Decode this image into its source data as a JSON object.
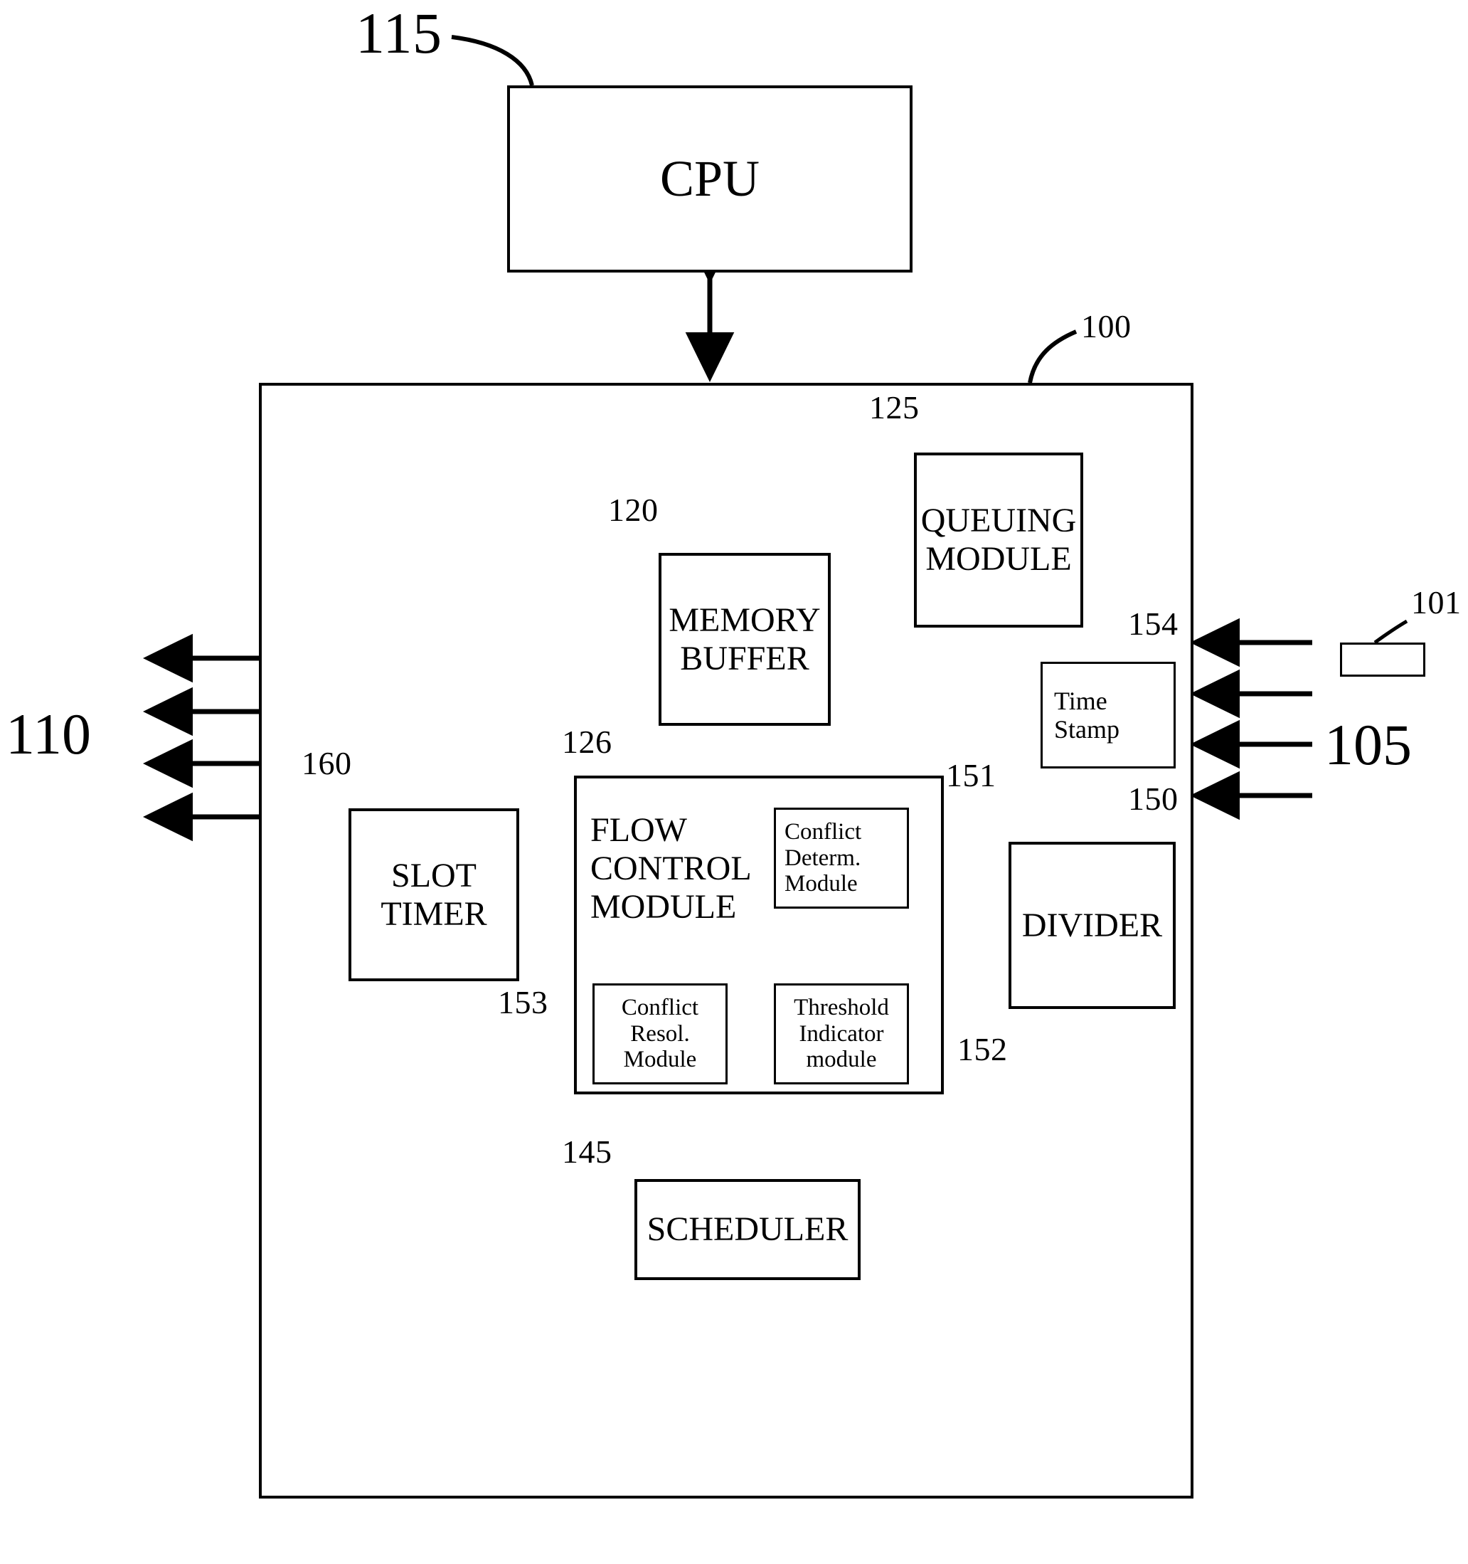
{
  "figure": {
    "type": "patent-block-diagram",
    "background_color": "#ffffff",
    "line_color": "#000000"
  },
  "blocks": {
    "cpu": {
      "label": "CPU",
      "ref": "115"
    },
    "device": {
      "ref": "100"
    },
    "memory_buffer": {
      "line1": "MEMORY",
      "line2": "BUFFER",
      "ref": "120"
    },
    "queuing_module": {
      "line1": "QUEUING",
      "line2": "MODULE",
      "ref": "125"
    },
    "time_stamp": {
      "line1": "Time",
      "line2": "Stamp",
      "ref": "154"
    },
    "slot_timer": {
      "line1": "SLOT",
      "line2": "TIMER",
      "ref": "160"
    },
    "flow_control_module": {
      "line1": "FLOW",
      "line2": "CONTROL",
      "line3": "MODULE",
      "ref": "126"
    },
    "conflict_determ_module": {
      "line1": "Conflict",
      "line2": "Determ.",
      "line3": "Module",
      "ref": "151"
    },
    "conflict_resol_module": {
      "line1": "Conflict",
      "line2": "Resol.",
      "line3": "Module",
      "ref": "153"
    },
    "threshold_indicator_module": {
      "line1": "Threshold",
      "line2": "Indicator",
      "line3": "module",
      "ref": "152"
    },
    "divider": {
      "label": "DIVIDER",
      "ref": "150"
    },
    "scheduler": {
      "label": "SCHEDULER",
      "ref": "145"
    },
    "packet": {
      "ref": "101"
    }
  },
  "port_groups": {
    "outputs_left": {
      "ref": "110",
      "count": 4,
      "direction": "out"
    },
    "inputs_right": {
      "ref": "105",
      "count": 4,
      "direction": "in"
    }
  },
  "connections": [
    {
      "from": "cpu",
      "to": "device",
      "style": "double-arrow"
    },
    {
      "from": "memory_buffer",
      "to": "queuing_module",
      "style": "double-arrow"
    },
    {
      "from": "time_stamp",
      "to": "queuing_module",
      "style": "single-arrow-up"
    },
    {
      "from": "memory_buffer",
      "to": "flow_control_module",
      "style": "double-arrow"
    },
    {
      "from": "slot_timer",
      "to": "flow_control_module",
      "style": "double-arrow"
    },
    {
      "from": "flow_control_module",
      "to": "divider",
      "style": "double-arrow"
    },
    {
      "from": "flow_control_module",
      "to": "scheduler",
      "style": "double-arrow"
    }
  ]
}
